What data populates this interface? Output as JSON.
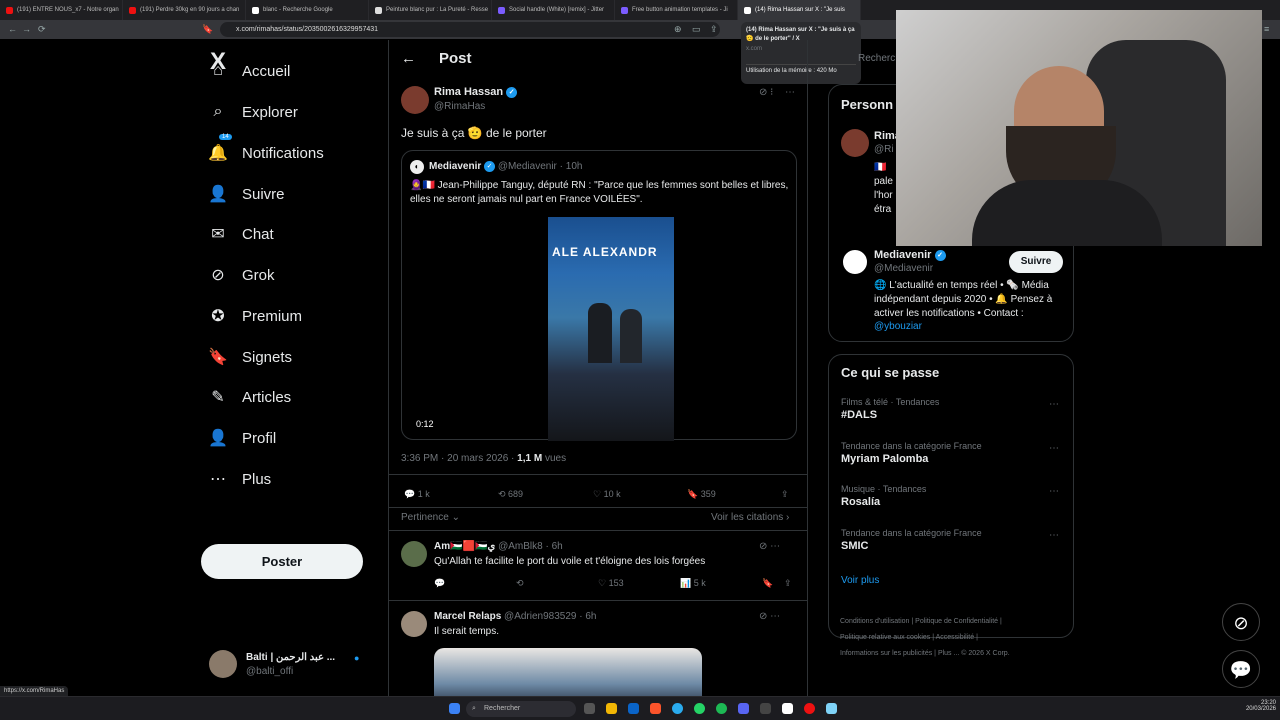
{
  "browser": {
    "tabs": [
      {
        "title": "(191) ENTRE NOUS_x7 - Notre organ",
        "color": "#e11"
      },
      {
        "title": "(191) Perdre 30kg en 90 jours a chan",
        "color": "#e11"
      },
      {
        "title": "blanc - Recherche Google",
        "color": "#fff"
      },
      {
        "title": "Peinture blanc pur : La Pureté - Resse",
        "color": "#ddd"
      },
      {
        "title": "Social handle (White) [remix] - Jitter",
        "color": "#7b5cff"
      },
      {
        "title": "Free button animation templates - Ji",
        "color": "#7b5cff"
      },
      {
        "title": "(14) Rima Hassan sur X : \"Je suis",
        "color": "#fff"
      }
    ],
    "url": "x.com/rimahas/status/2035002616329957431",
    "tooltip": {
      "title": "(14) Rima Hassan sur X : \"Je suis à ça 🫡 de le porter\" / X",
      "domain": "x.com",
      "memory": "Utilisation de la mémoire : 420 Mo"
    },
    "status_url": "https://x.com/RimaHas"
  },
  "sidebar": {
    "logo": "X",
    "items": [
      {
        "label": "Accueil",
        "icon": "home-icon",
        "glyph": "⌂"
      },
      {
        "label": "Explorer",
        "icon": "search-icon",
        "glyph": "⌕"
      },
      {
        "label": "Notifications",
        "icon": "bell-icon",
        "glyph": "🔔"
      },
      {
        "label": "Suivre",
        "icon": "person-add-icon",
        "glyph": "👤"
      },
      {
        "label": "Chat",
        "icon": "mail-icon",
        "glyph": "✉"
      },
      {
        "label": "Grok",
        "icon": "grok-icon",
        "glyph": "⊘"
      },
      {
        "label": "Premium",
        "icon": "premium-icon",
        "glyph": "✪"
      },
      {
        "label": "Signets",
        "icon": "bookmark-icon",
        "glyph": "🔖"
      },
      {
        "label": "Articles",
        "icon": "article-icon",
        "glyph": "✎"
      },
      {
        "label": "Profil",
        "icon": "profile-icon",
        "glyph": "👤"
      },
      {
        "label": "Plus",
        "icon": "more-icon",
        "glyph": "⋯"
      }
    ],
    "notif_count": "14",
    "post_button": "Poster",
    "account": {
      "name": "Balti | عبد الرحمن ...",
      "handle": "@balti_offi"
    }
  },
  "post": {
    "header": "Post",
    "author": {
      "name": "Rima Hassan",
      "handle": "@RimaHas"
    },
    "text": "Je suis à ça 🫡 de le porter",
    "quote": {
      "author": "Mediavenir",
      "handle": "@Mediavenir",
      "time": "· 10h",
      "text": "🧕🇫🇷 Jean-Philippe Tanguy, député RN : \"Parce que les femmes sont belles et libres, elles ne seront jamais nul part en France VOILÉES\".",
      "video_time": "0:12",
      "video_banner": "ALE ALEXANDR"
    },
    "meta_time": "3:36 PM · 20 mars 2026 ·",
    "views_count": "1,1 M",
    "views_label": "vues",
    "actions": {
      "replies": "1 k",
      "reposts": "689",
      "likes": "10 k",
      "bookmarks": "359"
    },
    "sort_label": "Pertinence",
    "citations_link": "Voir les citations"
  },
  "replies": [
    {
      "name": "Am🇵🇸🟥🇵🇸ي",
      "handle": "@AmBlk8",
      "time": "· 6h",
      "text": "Qu'Allah te facilite le port du voile et t'éloigne des lois forgées",
      "likes": "153",
      "views": "5 k"
    },
    {
      "name": "Marcel Relaps",
      "handle": "@Adrien983529",
      "time": "· 6h",
      "text": "Il serait temps."
    }
  ],
  "right": {
    "search_placeholder": "Rechercher",
    "people_title": "Personn",
    "people": [
      {
        "name": "Rima",
        "handle": "@Ri",
        "bio": "🇫🇷 pale l'hor étra inter"
      },
      {
        "name": "Mediavenir",
        "handle": "@Mediavenir",
        "follow": "Suivre",
        "bio": "🌐 L'actualité en temps réel • 🗞️ Média indépendant depuis 2020 • 🔔 Pensez à activer les notifications • Contact :",
        "link": "@ybouziar"
      }
    ],
    "trends_title": "Ce qui se passe",
    "trends": [
      {
        "category": "Films & télé · Tendances",
        "name": "#DALS"
      },
      {
        "category": "Tendance dans la catégorie France",
        "name": "Myriam Palomba"
      },
      {
        "category": "Musique · Tendances",
        "name": "Rosalía"
      },
      {
        "category": "Tendance dans la catégorie France",
        "name": "SMIC"
      }
    ],
    "see_more": "Voir plus",
    "footer": [
      "Conditions d'utilisation",
      "Politique de Confidentialité",
      "Politique relative aux cookies",
      "Accessibilité",
      "Informations sur les publicités",
      "Plus ...",
      "© 2026 X Corp."
    ]
  },
  "taskbar": {
    "search_placeholder": "Rechercher",
    "time": "23:20",
    "date": "20/03/2026"
  }
}
